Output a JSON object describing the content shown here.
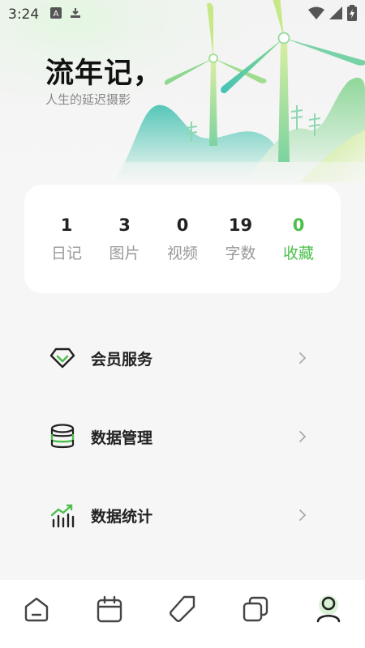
{
  "status_bar": {
    "time": "3:24",
    "left_icons": [
      "font-notification-icon",
      "download-notification-icon"
    ],
    "right_icons": [
      "wifi-icon",
      "signal-icon",
      "battery-charging-icon"
    ]
  },
  "header": {
    "title": "流年记，",
    "subtitle": "人生的延迟摄影"
  },
  "stats": [
    {
      "value": "1",
      "label": "日记",
      "active": false
    },
    {
      "value": "3",
      "label": "图片",
      "active": false
    },
    {
      "value": "0",
      "label": "视频",
      "active": false
    },
    {
      "value": "19",
      "label": "字数",
      "active": false
    },
    {
      "value": "0",
      "label": "收藏",
      "active": true
    }
  ],
  "menu": [
    {
      "label": "会员服务",
      "icon": "diamond-icon"
    },
    {
      "label": "数据管理",
      "icon": "database-icon"
    },
    {
      "label": "数据统计",
      "icon": "bar-chart-trend-icon"
    }
  ],
  "tabbar": {
    "tabs": [
      "home-icon",
      "calendar-icon",
      "tag-icon",
      "copy-icon",
      "profile-icon"
    ],
    "active_index": 4
  },
  "colors": {
    "accent": "#4cbf4c",
    "background": "#f6f6f6",
    "card": "#ffffff",
    "text_primary": "#222222",
    "text_secondary": "#999999",
    "icon": "#444444"
  }
}
